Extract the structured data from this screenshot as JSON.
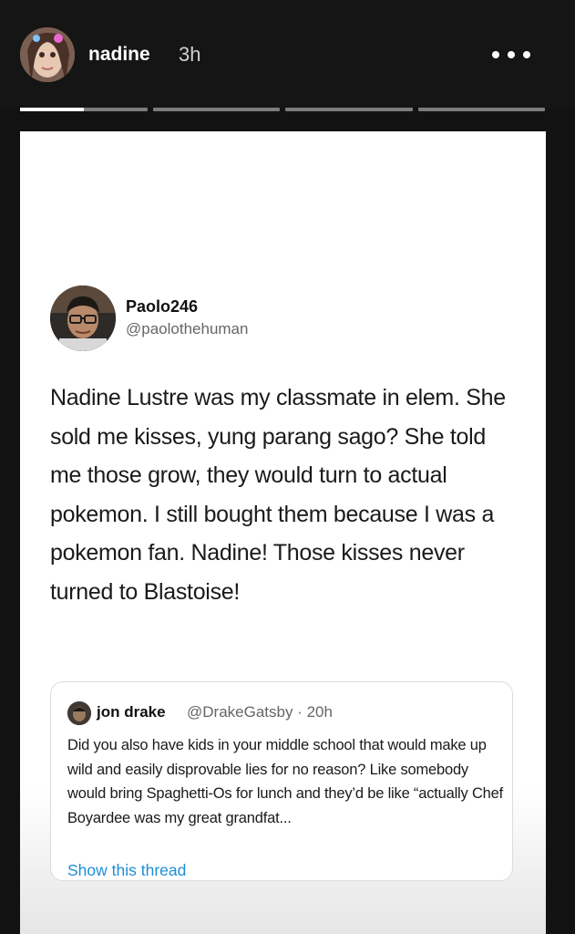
{
  "story": {
    "username": "nadine",
    "time_ago": "3h",
    "menu_icon": "more-horizontal-icon",
    "progress": {
      "segments": 4,
      "active_index": 0,
      "active_fill": 0.5
    }
  },
  "tweet": {
    "display_name": "Paolo246",
    "handle": "@paolothehuman",
    "text": "Nadine Lustre was my classmate in elem. She sold me kisses, yung parang sago? She told me those grow, they would turn to actual pokemon. I still bought them because I was a pokemon fan. Nadine! Those kisses never turned to Blastoise!"
  },
  "quoted_tweet": {
    "display_name": "jon drake",
    "handle_time": "@DrakeGatsby · 20h",
    "text": "Did you also have kids in your middle school that would make up wild and easily disprovable lies for no reason? Like somebody would bring Spaghetti-Os for lunch and they’d be like “actually Chef Boyardee was my great grandfat...",
    "link_label": "Show this thread",
    "link_color": "#1d8fd6"
  }
}
